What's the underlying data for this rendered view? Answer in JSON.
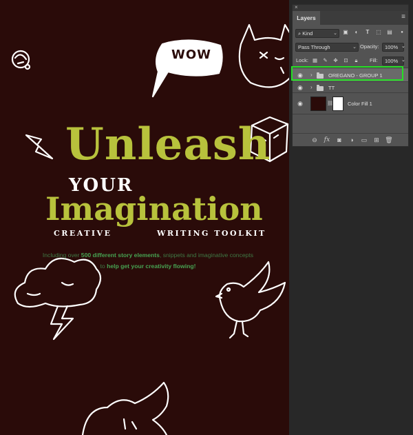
{
  "artwork": {
    "wow": "WOW",
    "title_line1": "Unleash",
    "title_line2": "YOUR",
    "title_line3": "Imagination",
    "subtitle_left": "CREATIVE",
    "subtitle_right": "WRITING TOOLKIT",
    "desc_part1": "Including over ",
    "desc_bold1": "500 different story elements",
    "desc_part2": ", snippets and imaginative concepts to ",
    "desc_bold2": "help get your creativity flowing!"
  },
  "panel": {
    "close": "×",
    "tab": "Layers",
    "menu_icon": "≡",
    "filter_kind": "Kind",
    "blend_mode": "Pass Through",
    "opacity_label": "Opacity:",
    "opacity_value": "100%",
    "lock_label": "Lock:",
    "fill_label": "Fill:",
    "fill_value": "100%",
    "layers": [
      {
        "name": "OREGANO - GROUP 1",
        "type": "group",
        "selected": true
      },
      {
        "name": "TT",
        "type": "group",
        "selected": false
      },
      {
        "name": "Color Fill 1",
        "type": "fill",
        "selected": false
      }
    ]
  },
  "colors": {
    "canvas_bg": "#2a0b09",
    "title_green": "#b8c23c",
    "desc_green": "#47a352",
    "highlight": "#25e024",
    "panel_bg": "#535353"
  }
}
